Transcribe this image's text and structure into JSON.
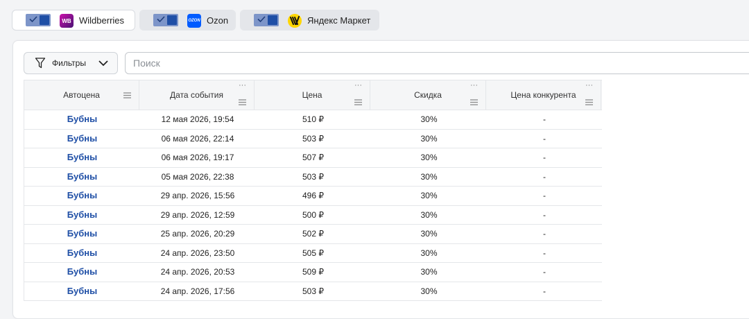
{
  "marketplaces": [
    {
      "label": "Wildberries",
      "logo_text": "WB",
      "logo": "wildberries-logo",
      "active": true,
      "enabled": true
    },
    {
      "label": "Ozon",
      "logo_text": "OZON",
      "logo": "ozon-logo",
      "active": false,
      "enabled": true
    },
    {
      "label": "Яндекс Маркет",
      "logo_text": "",
      "logo": "yandex-market-logo",
      "active": false,
      "enabled": true
    }
  ],
  "toolbar": {
    "filters_label": "Фильтры",
    "search_placeholder": "Поиск",
    "search_value": ""
  },
  "table": {
    "columns": [
      "Автоцена",
      "Дата события",
      "Цена",
      "Скидка",
      "Цена конкурента"
    ],
    "rows": [
      [
        "Бубны",
        "12 мая 2026, 19:54",
        "510 ₽",
        "30%",
        "-"
      ],
      [
        "Бубны",
        "06 мая 2026, 22:14",
        "503 ₽",
        "30%",
        "-"
      ],
      [
        "Бубны",
        "06 мая 2026, 19:17",
        "507 ₽",
        "30%",
        "-"
      ],
      [
        "Бубны",
        "05 мая 2026, 22:38",
        "503 ₽",
        "30%",
        "-"
      ],
      [
        "Бубны",
        "29 апр. 2026, 15:56",
        "496 ₽",
        "30%",
        "-"
      ],
      [
        "Бубны",
        "29 апр. 2026, 12:59",
        "500 ₽",
        "30%",
        "-"
      ],
      [
        "Бубны",
        "25 апр. 2026, 20:29",
        "502 ₽",
        "30%",
        "-"
      ],
      [
        "Бубны",
        "24 апр. 2026, 23:50",
        "505 ₽",
        "30%",
        "-"
      ],
      [
        "Бубны",
        "24 апр. 2026, 20:53",
        "509 ₽",
        "30%",
        "-"
      ],
      [
        "Бубны",
        "24 апр. 2026, 17:56",
        "503 ₽",
        "30%",
        "-"
      ]
    ]
  },
  "colors": {
    "accent": "#1f4fa6",
    "toggle_track": "#7d95c9",
    "wildberries": "#cb11ab",
    "ozon": "#005bff",
    "yandex_market": "#ffd600"
  }
}
